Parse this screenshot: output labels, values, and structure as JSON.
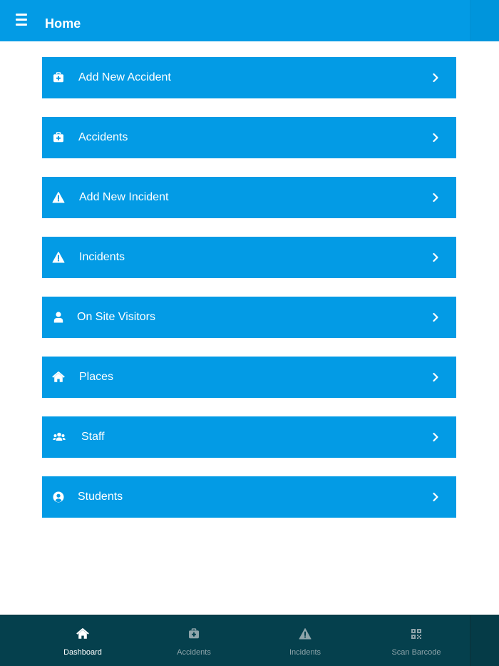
{
  "header": {
    "title": "Home",
    "menu_icon": "hamburger-menu-icon"
  },
  "menu": {
    "items": [
      {
        "label": "Add New Accident",
        "icon": "first-aid-kit-icon"
      },
      {
        "label": "Accidents",
        "icon": "first-aid-kit-icon"
      },
      {
        "label": "Add New Incident",
        "icon": "warning-triangle-icon"
      },
      {
        "label": "Incidents",
        "icon": "warning-triangle-icon"
      },
      {
        "label": "On Site Visitors",
        "icon": "user-icon"
      },
      {
        "label": "Places",
        "icon": "home-icon"
      },
      {
        "label": "Staff",
        "icon": "users-group-icon"
      },
      {
        "label": "Students",
        "icon": "user-circle-icon"
      }
    ],
    "chevron_icon": "chevron-right-icon"
  },
  "bottom_nav": {
    "tabs": [
      {
        "label": "Dashboard",
        "icon": "home-icon",
        "active": true
      },
      {
        "label": "Accidents",
        "icon": "first-aid-kit-icon",
        "active": false
      },
      {
        "label": "Incidents",
        "icon": "warning-triangle-icon",
        "active": false
      },
      {
        "label": "Scan Barcode",
        "icon": "qr-code-icon",
        "active": false
      }
    ]
  },
  "colors": {
    "primary": "#039be5",
    "nav_background": "#05404d",
    "nav_inactive": "#8ea4aa",
    "nav_active": "#ffffff"
  }
}
